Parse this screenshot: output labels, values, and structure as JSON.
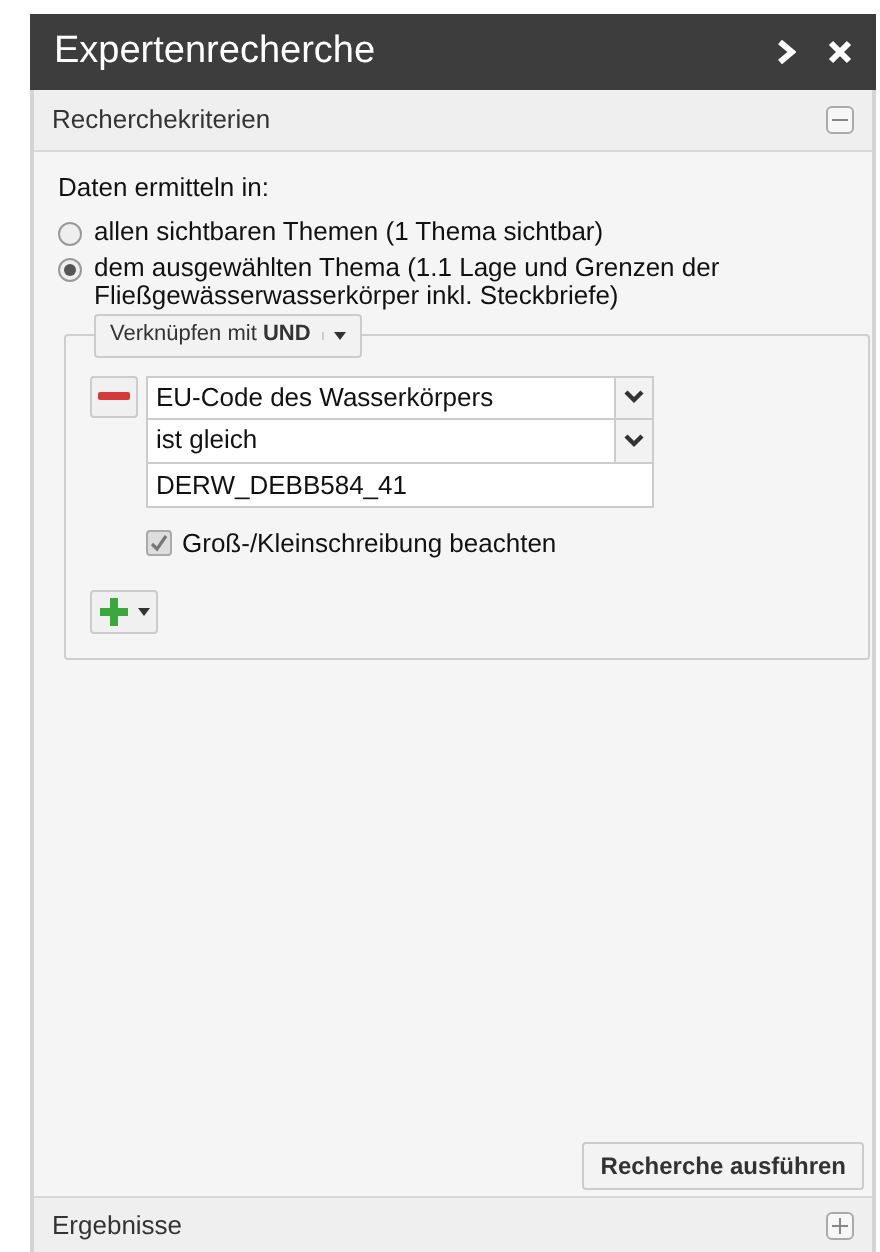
{
  "window": {
    "title": "Expertenrecherche",
    "buttons": [
      {
        "kind": "arrow"
      },
      {
        "kind": "close"
      }
    ]
  },
  "criteria": {
    "title": "Recherchekriterien",
    "expanded": true,
    "prompt": "Daten ermitteln in:",
    "options": [
      {
        "label": "allen sichtbaren Themen (1 Thema sichtbar)",
        "selected": false
      },
      {
        "label": "dem ausgewählten Thema (1.1 Lage und Grenzen der Fließgewässerwasserkörper inkl. Steckbriefe)",
        "selected": true
      }
    ],
    "combine": "Verknüpfen mit **UND**",
    "condition": {
      "attribute": "EU-Code des Wasserkörpers",
      "operator": "ist gleich",
      "value": "DERW_DEBB584_41",
      "case_label": "Groß-/Kleinschreibung beachten",
      "case_checked": true
    },
    "submit": "Recherche ausführen"
  },
  "results": {
    "title": "Ergebnisse",
    "expanded": false
  }
}
